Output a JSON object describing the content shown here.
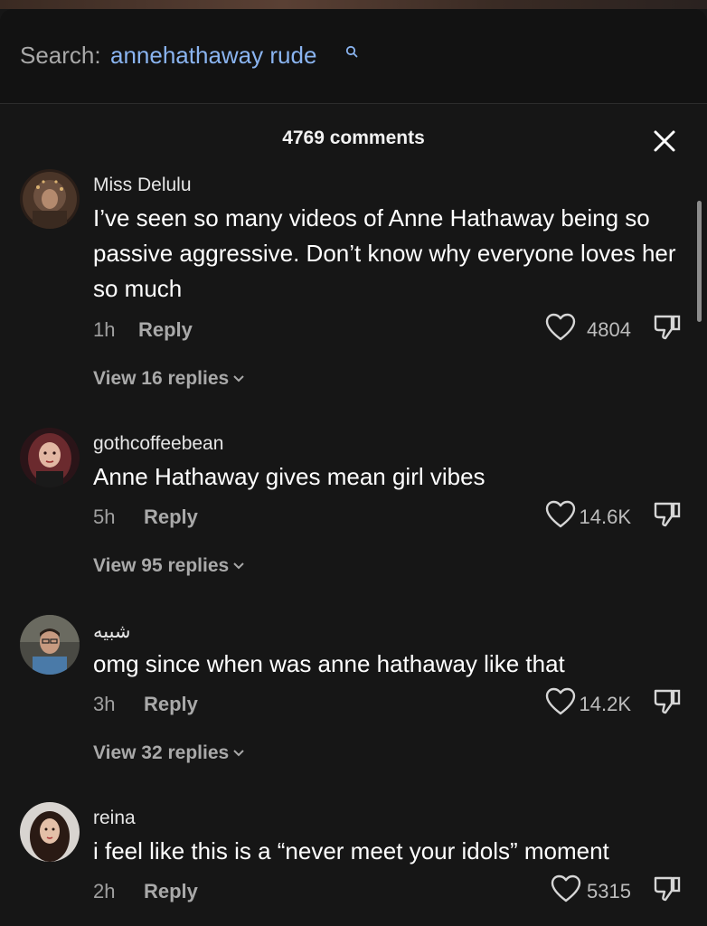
{
  "search": {
    "prefix": "Search:",
    "query": "annehathaway rude"
  },
  "header": {
    "comment_count": "4769 comments"
  },
  "comments": [
    {
      "username": "Miss Delulu",
      "text": "I’ve seen so many videos of Anne Hathaway being so passive aggressive. Don’t know why everyone loves her so much",
      "time": "1h",
      "reply_label": "Reply",
      "likes": "4804",
      "view_replies": "View 16 replies"
    },
    {
      "username": "gothcoffeebean",
      "text": "Anne Hathaway gives mean girl vibes",
      "time": "5h",
      "reply_label": "Reply",
      "likes": "14.6K",
      "view_replies": "View 95 replies"
    },
    {
      "username": "شبيه",
      "text": "omg since when was anne hathaway like that",
      "time": "3h",
      "reply_label": "Reply",
      "likes": "14.2K",
      "view_replies": "View 32 replies"
    },
    {
      "username": "reina",
      "text": "i feel like this is a “never meet your idols” moment",
      "time": "2h",
      "reply_label": "Reply",
      "likes": "5315"
    }
  ],
  "colors": {
    "background": "#161616",
    "search_query": "#8ab4f0",
    "muted_text": "#a9a9a9"
  },
  "icons": [
    "search-icon",
    "close-icon",
    "heart-icon",
    "thumbs-down-icon",
    "chevron-down-icon"
  ]
}
